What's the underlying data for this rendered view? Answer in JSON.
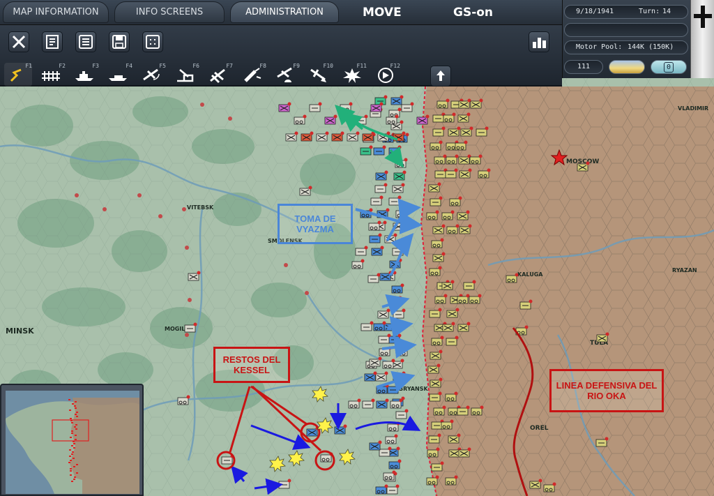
{
  "tabs": [
    {
      "label": "MAP INFORMATION",
      "active": false
    },
    {
      "label": "INFO SCREENS",
      "active": false
    },
    {
      "label": "ADMINISTRATION",
      "active": true
    }
  ],
  "mode": "MOVE",
  "toggle": "GS-on",
  "info": {
    "date": "9/18/1941",
    "turn_label": "Turn:",
    "turn": "14",
    "motor_pool_label": "Motor Pool:",
    "motor_pool": "144K (150K)",
    "counter": "111",
    "toggle_value": "0"
  },
  "toolbar": {
    "row1": [
      "close-icon",
      "unit-list-icon",
      "report-icon",
      "save-icon",
      "grid-icon"
    ],
    "row1_right": "chart-icon",
    "row2": [
      {
        "key": "F1",
        "icon": "move-path-icon",
        "selected": true
      },
      {
        "key": "F2",
        "icon": "rail-icon"
      },
      {
        "key": "F3",
        "icon": "ship-icon"
      },
      {
        "key": "F4",
        "icon": "naval-transport-icon"
      },
      {
        "key": "F5",
        "icon": "air-recon-icon"
      },
      {
        "key": "F6",
        "icon": "airbase-icon"
      },
      {
        "key": "F7",
        "icon": "air-transfer-icon"
      },
      {
        "key": "F8",
        "icon": "bomb-icon"
      },
      {
        "key": "F9",
        "icon": "paradrop-icon"
      },
      {
        "key": "F10",
        "icon": "air-strike-icon"
      },
      {
        "key": "F11",
        "icon": "explosion-icon"
      },
      {
        "key": "F12",
        "icon": "next-icon"
      }
    ],
    "upload": "upload-icon"
  },
  "annotations": {
    "vyazma": "TOMA DE VYAZMA",
    "kessel": "RESTOS DEL KESSEL",
    "oka": "LINEA DEFENSIVA DEL RIO OKA"
  },
  "cities": [
    "VITEBSK",
    "SMOLENSK",
    "MINSK",
    "MOGILEV",
    "MOSCOW",
    "TULA",
    "KALUGA",
    "RYAZAN",
    "OREL",
    "BRYANSK",
    "VLADIMIR"
  ],
  "colors": {
    "german_unit": "#d8d8cc",
    "soviet_unit": "#d6cf7a",
    "soviet_territory": "#b5957a",
    "axis_territory": "#9fb9a4",
    "front_line": "#e0203a",
    "arrow_blue": "#1a1ae0",
    "arrow_light_blue": "#4a8ad8",
    "arrow_green": "#22b07a",
    "annotation_red": "#c81414"
  }
}
